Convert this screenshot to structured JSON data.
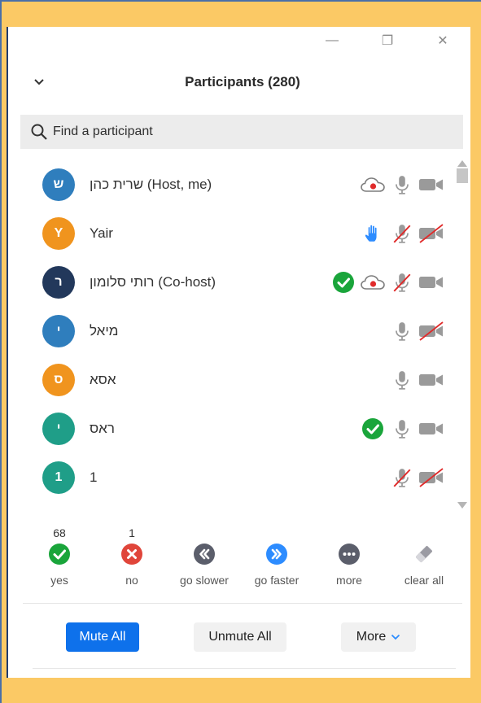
{
  "window": {
    "minimize": "—",
    "restore": "❐",
    "close": "✕"
  },
  "header": {
    "title": "Participants (280)"
  },
  "search": {
    "placeholder": "Find a participant"
  },
  "participants": [
    {
      "initial": "ש",
      "name": "שרית כהן (Host, me)",
      "color": "#2f7ebd",
      "raised_hand": false,
      "approved": false,
      "recording": true,
      "mic_muted": false,
      "video_off": false
    },
    {
      "initial": "Y",
      "name": "Yair",
      "color": "#f0941e",
      "raised_hand": true,
      "approved": false,
      "recording": false,
      "mic_muted": true,
      "video_off": true
    },
    {
      "initial": "ר",
      "name": "רותי סלומון (Co-host)",
      "color": "#22385b",
      "raised_hand": false,
      "approved": true,
      "recording": true,
      "mic_muted": true,
      "video_off": false
    },
    {
      "initial": "י",
      "name": "מיאל",
      "color": "#2f7ebd",
      "raised_hand": false,
      "approved": false,
      "recording": false,
      "mic_muted": false,
      "video_off": true
    },
    {
      "initial": "ס",
      "name": "אסא",
      "color": "#f0941e",
      "raised_hand": false,
      "approved": false,
      "recording": false,
      "mic_muted": false,
      "video_off": false
    },
    {
      "initial": "י",
      "name": "ראס",
      "color": "#1f9e88",
      "raised_hand": false,
      "approved": true,
      "recording": false,
      "mic_muted": false,
      "video_off": false
    },
    {
      "initial": "1",
      "name": "1",
      "color": "#1f9e88",
      "raised_hand": false,
      "approved": false,
      "recording": false,
      "mic_muted": true,
      "video_off": true
    }
  ],
  "feedback": {
    "yes": {
      "count": "68",
      "label": "yes"
    },
    "no": {
      "count": "1",
      "label": "no"
    },
    "slower": {
      "count": "",
      "label": "go slower"
    },
    "faster": {
      "count": "",
      "label": "go faster"
    },
    "more": {
      "count": "",
      "label": "more"
    },
    "clear": {
      "count": "",
      "label": "clear all"
    }
  },
  "actions": {
    "mute_all": "Mute All",
    "unmute_all": "Unmute All",
    "more": "More"
  },
  "colors": {
    "accent": "#0e71eb",
    "approve_green": "#1aa53b",
    "deny_red": "#e0453a",
    "slower_gray": "#5b5e6b",
    "faster_blue": "#2d8cff",
    "icon_gray": "#9a9a9a",
    "muted_red": "#e02b2b",
    "frame": "#fbc965"
  }
}
